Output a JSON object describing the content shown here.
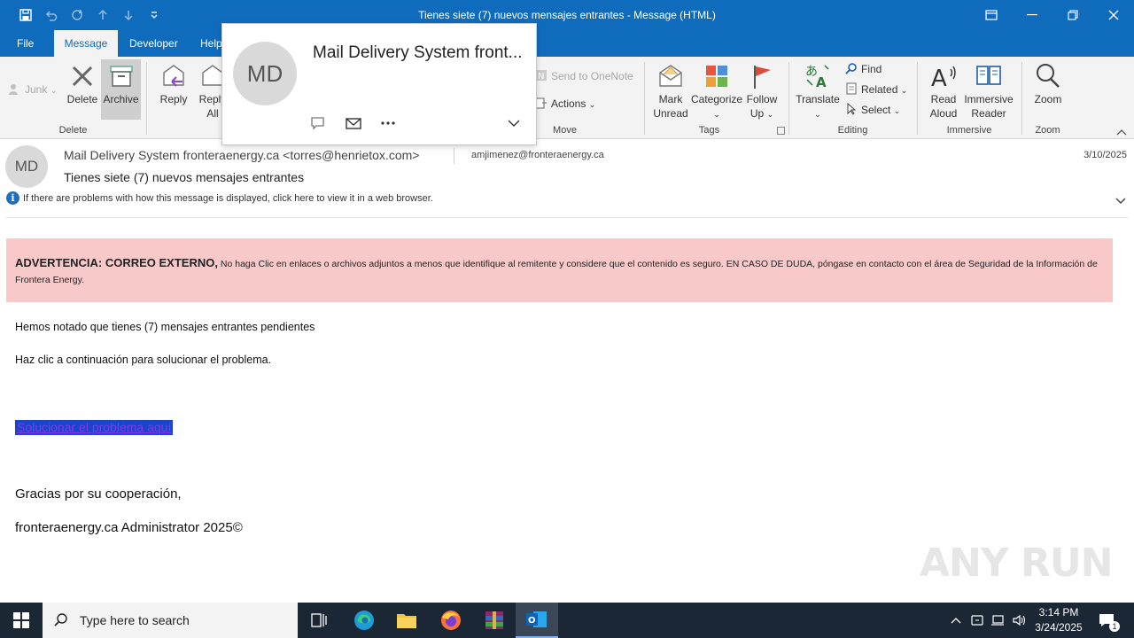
{
  "window": {
    "title": "Tienes siete (7) nuevos mensajes entrantes  -  Message (HTML)"
  },
  "tabs": [
    "File",
    "Message",
    "Developer",
    "Help"
  ],
  "ribbon": {
    "junk": "Junk",
    "delete": "Delete",
    "archive": "Archive",
    "reply": "Reply",
    "reply_all_1": "Reply",
    "reply_all_2": "All",
    "send_to_onenote": "Send to OneNote",
    "actions": "Actions",
    "mark_unread_1": "Mark",
    "mark_unread_2": "Unread",
    "categorize": "Categorize",
    "follow_up_1": "Follow",
    "follow_up_2": "Up",
    "translate": "Translate",
    "find": "Find",
    "related": "Related",
    "select": "Select",
    "read_aloud_1": "Read",
    "read_aloud_2": "Aloud",
    "immersive_1": "Immersive",
    "immersive_2": "Reader",
    "zoom": "Zoom",
    "groups": {
      "delete": "Delete",
      "move": "Move",
      "tags": "Tags",
      "editing": "Editing",
      "immersive": "Immersive",
      "zoom": "Zoom"
    }
  },
  "contact_card": {
    "initials": "MD",
    "name": "Mail Delivery System front..."
  },
  "message": {
    "avatar_initials": "MD",
    "from": "Mail Delivery System fronteraenergy.ca <torres@henrietox.com>",
    "to": "amjimenez@fronteraenergy.ca",
    "date": "3/10/2025",
    "subject": "Tienes siete (7) nuevos mensajes entrantes",
    "info_bar": "If there are problems with how this message is displayed, click here to view it in a web browser."
  },
  "body": {
    "warning_title": "ADVERTENCIA: CORREO EXTERNO,",
    "warning_text": " No haga Clic en enlaces o archivos adjuntos a menos que identifique al remitente y considere que el contenido es seguro. EN CASO DE DUDA, póngase en contacto con el área de Seguridad de la Información de Frontera Energy.",
    "line1": "Hemos notado que tienes (7) mensajes entrantes pendientes",
    "line2": "Haz clic a continuación para solucionar el problema.",
    "link": "Solucionar el problema aquí",
    "thanks": "Gracias por su cooperación,",
    "signature": "fronteraenergy.ca Administrator 2025©"
  },
  "watermark": "ANY RUN",
  "taskbar": {
    "search_placeholder": "Type here to search",
    "time": "3:14 PM",
    "date": "3/24/2025",
    "notification_count": "1"
  },
  "colors": {
    "accent": "#0f6cbd",
    "warning_bg": "#f9c8c8",
    "link_bg": "#1a44c9"
  }
}
